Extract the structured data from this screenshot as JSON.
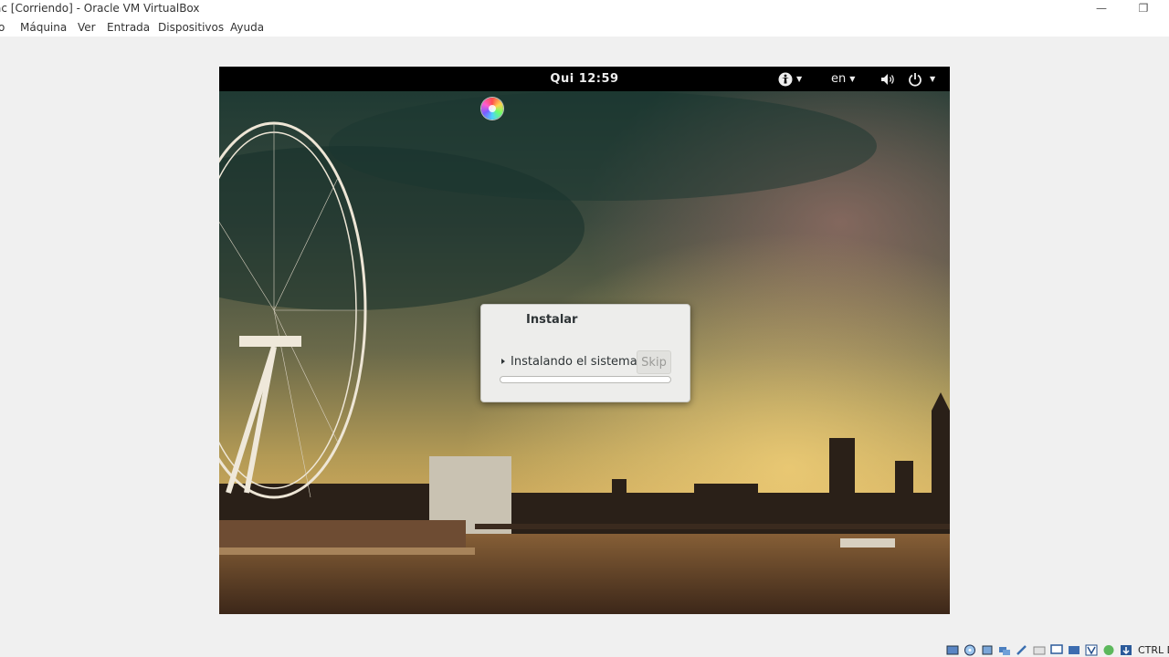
{
  "window": {
    "title": "ac [Corriendo] - Oracle VM VirtualBox",
    "minimize_glyph": "—",
    "restore_glyph": "❐"
  },
  "menu": {
    "items": [
      {
        "label": "o"
      },
      {
        "label": "Máquina"
      },
      {
        "label": "Ver"
      },
      {
        "label": "Entrada"
      },
      {
        "label": "Dispositivos"
      },
      {
        "label": "Ayuda"
      }
    ]
  },
  "guest": {
    "clock": "Qui 12:59",
    "language": "en",
    "icons": {
      "accessibility": "accessibility-icon",
      "volume": "volume-icon",
      "power": "power-icon"
    }
  },
  "dialog": {
    "title": "Instalar",
    "step_label": "Instalando el sistema",
    "skip_label": "Skip",
    "progress_fraction": 0
  },
  "status": {
    "host_key": "CTRL D"
  },
  "colors": {
    "gnome_bar": "#000000",
    "dialog_bg": "#ededeb",
    "host_bg": "#f0f0f0"
  }
}
